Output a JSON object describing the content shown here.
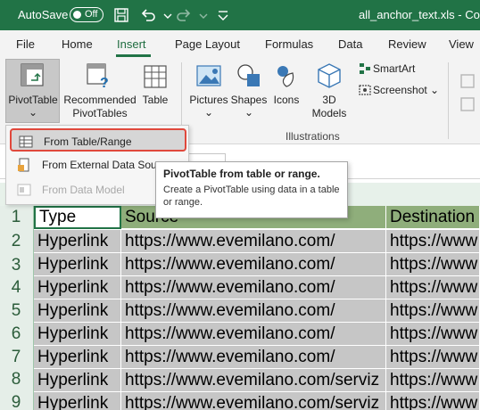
{
  "titlebar": {
    "autosave_label": "AutoSave",
    "autosave_state": "Off",
    "filename": "all_anchor_text.xls  -  Com",
    "bg_color": "#217346"
  },
  "tabs": [
    {
      "label": "File"
    },
    {
      "label": "Home"
    },
    {
      "label": "Insert",
      "active": true
    },
    {
      "label": "Page Layout"
    },
    {
      "label": "Formulas"
    },
    {
      "label": "Data"
    },
    {
      "label": "Review"
    },
    {
      "label": "View"
    }
  ],
  "ribbon": {
    "pivottable_label": "PivotTable",
    "recommended_line1": "Recommended",
    "recommended_line2": "PivotTables",
    "table_label": "Table",
    "pictures_label": "Pictures",
    "shapes_label": "Shapes",
    "icons_label": "Icons",
    "models_line1": "3D",
    "models_line2": "Models",
    "smartart_label": "SmartArt",
    "screenshot_label": "Screenshot",
    "illustrations_group": "Illustrations"
  },
  "dropdown": {
    "items": [
      {
        "label": "From Table/Range",
        "icon": "table-range-icon",
        "state": "hover"
      },
      {
        "label": "From External Data Source",
        "icon": "external-data-icon",
        "state": "normal"
      },
      {
        "label": "From Data Model",
        "icon": "data-model-icon",
        "state": "disabled"
      }
    ]
  },
  "tooltip": {
    "title": "PivotTable from table or range.",
    "body": "Create a PivotTable using data in a table or range."
  },
  "sheet": {
    "row_numbers": [
      "1",
      "2",
      "3",
      "4",
      "5",
      "6",
      "7",
      "8",
      "9"
    ],
    "header": {
      "type": "Type",
      "source": "Source",
      "destination": "Destination"
    },
    "rows": [
      {
        "type": "Hyperlink",
        "source": "https://www.evemilano.com/",
        "destination": "https://www"
      },
      {
        "type": "Hyperlink",
        "source": "https://www.evemilano.com/",
        "destination": "https://www"
      },
      {
        "type": "Hyperlink",
        "source": "https://www.evemilano.com/",
        "destination": "https://www"
      },
      {
        "type": "Hyperlink",
        "source": "https://www.evemilano.com/",
        "destination": "https://www"
      },
      {
        "type": "Hyperlink",
        "source": "https://www.evemilano.com/",
        "destination": "https://www"
      },
      {
        "type": "Hyperlink",
        "source": "https://www.evemilano.com/",
        "destination": "https://www"
      },
      {
        "type": "Hyperlink",
        "source": "https://www.evemilano.com/serviz",
        "destination": "https://www"
      },
      {
        "type": "Hyperlink",
        "source": "https://www.evemilano.com/serviz",
        "destination": "https://www"
      }
    ]
  },
  "colors": {
    "accent": "#217346",
    "hover_border": "#e0483c",
    "selection": "#c6c6c6",
    "header_green": "#8fae7b"
  }
}
